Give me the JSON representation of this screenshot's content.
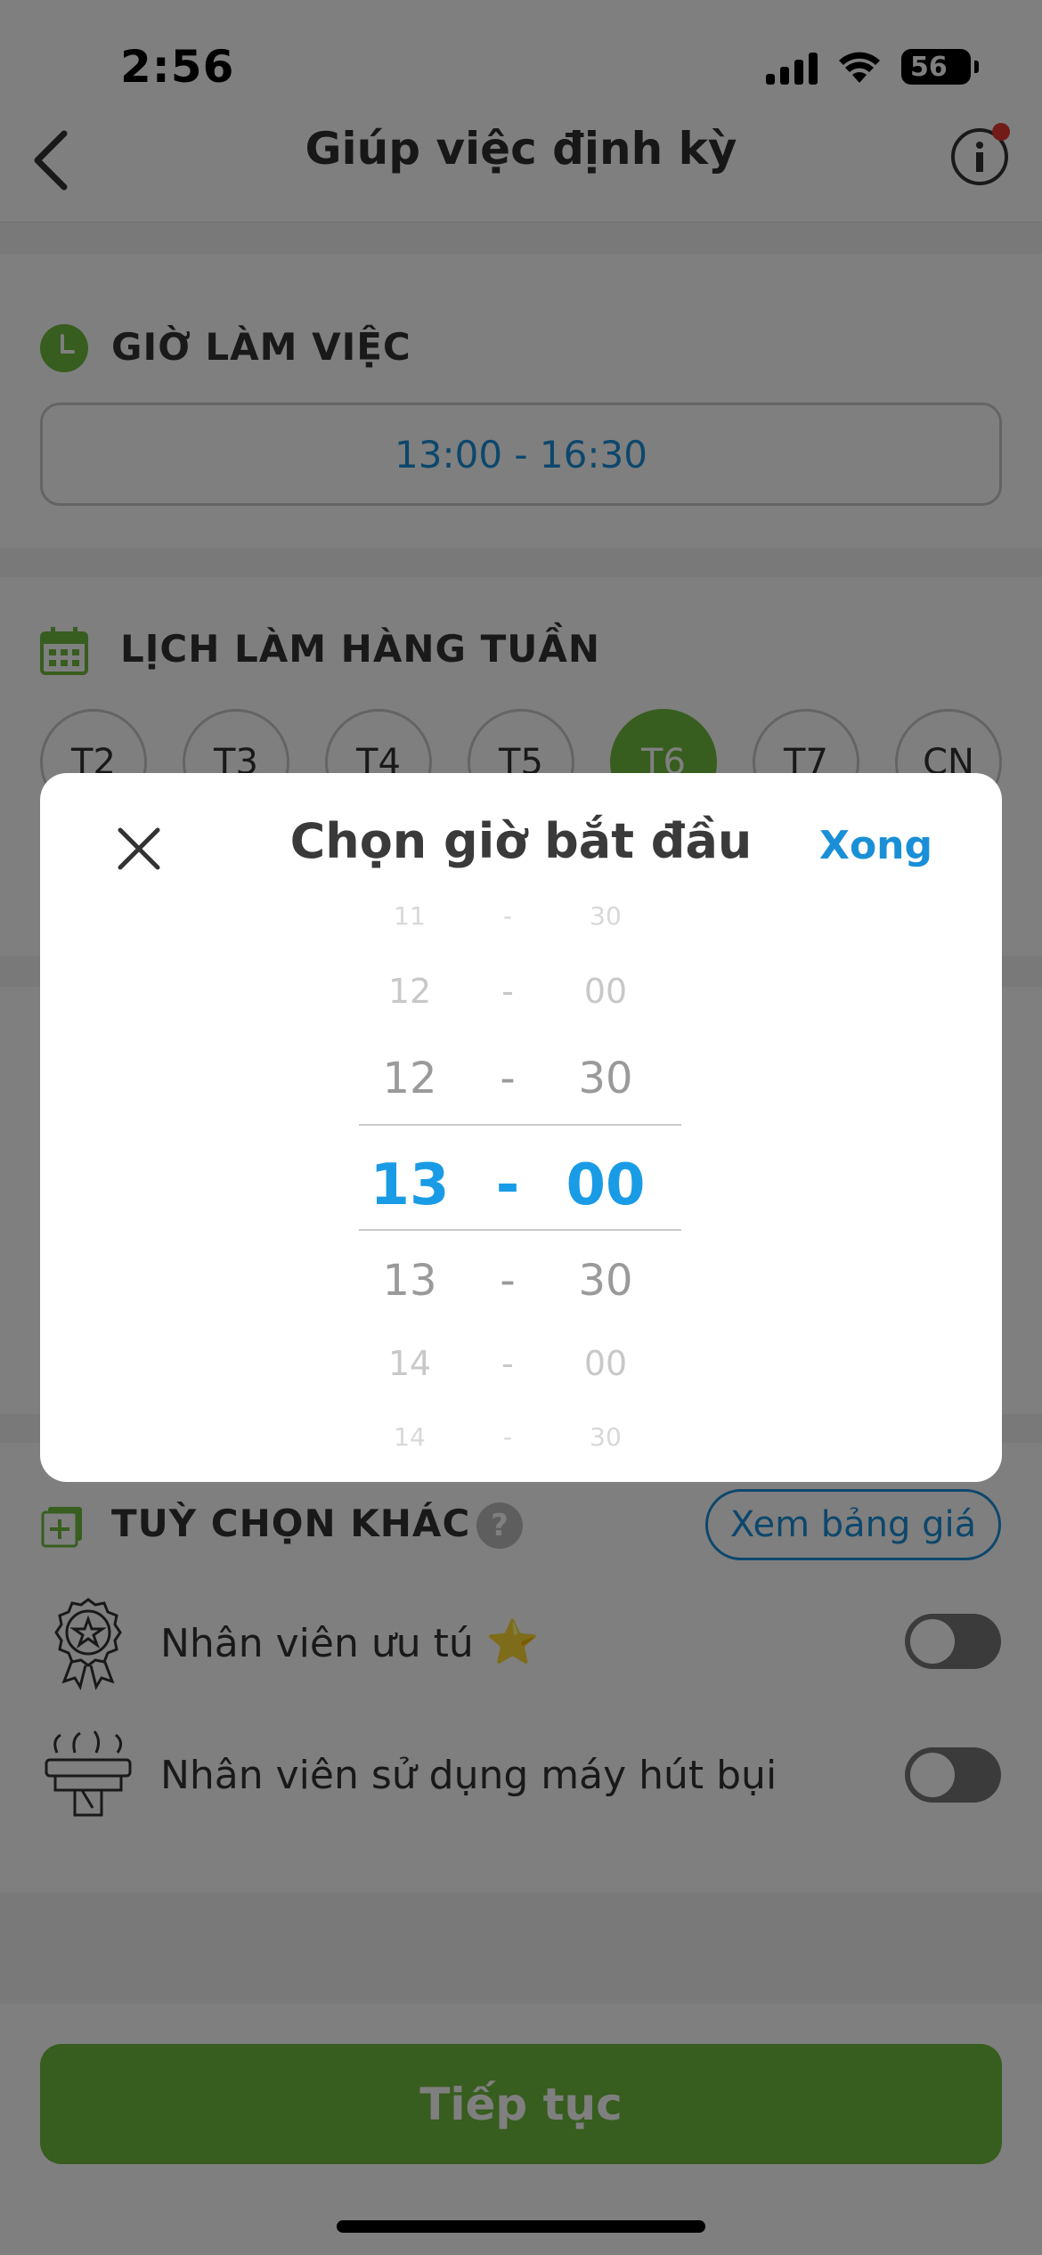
{
  "status_bar": {
    "time": "2:56",
    "battery": "56"
  },
  "header": {
    "title": "Giúp việc định kỳ"
  },
  "work_hours": {
    "title": "GIỜ LÀM VIỆC",
    "value": "13:00 - 16:30"
  },
  "weekly": {
    "title": "LỊCH LÀM HÀNG TUẦN",
    "days": [
      {
        "label": "T2",
        "selected": false
      },
      {
        "label": "T3",
        "selected": false
      },
      {
        "label": "T4",
        "selected": false
      },
      {
        "label": "T5",
        "selected": false
      },
      {
        "label": "T6",
        "selected": true
      },
      {
        "label": "T7",
        "selected": false
      },
      {
        "label": "CN",
        "selected": false
      }
    ]
  },
  "options": {
    "title": "TUỲ CHỌN KHÁC",
    "help": "?",
    "price_button": "Xem bảng giá",
    "items": [
      {
        "label": "Nhân viên ưu tú",
        "badge": "⭐",
        "icon": "award-medal-icon",
        "enabled": false
      },
      {
        "label": "Nhân viên sử dụng máy hút bụi",
        "icon": "vacuum-cleaner-icon",
        "enabled": false
      }
    ]
  },
  "continue_button": "Tiếp tục",
  "time_picker": {
    "title": "Chọn giờ bắt đầu",
    "done": "Xong",
    "separator": "-",
    "rows": [
      {
        "hour": "11",
        "minute": "30"
      },
      {
        "hour": "12",
        "minute": "00"
      },
      {
        "hour": "12",
        "minute": "30"
      },
      {
        "hour": "13",
        "minute": "00",
        "selected": true
      },
      {
        "hour": "13",
        "minute": "30"
      },
      {
        "hour": "14",
        "minute": "00"
      },
      {
        "hour": "14",
        "minute": "30"
      }
    ]
  },
  "colors": {
    "accent_blue": "#1a8fd8",
    "primary_green": "#6fba3f",
    "overlay": "rgba(0,0,0,0.5)"
  }
}
